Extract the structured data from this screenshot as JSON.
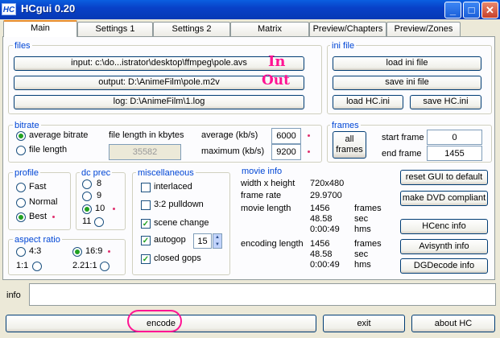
{
  "window": {
    "logo": "HC",
    "title": "HCgui 0.20",
    "minimize": "_",
    "maximize": "□",
    "close": "✕"
  },
  "tabs": [
    "Main",
    "Settings 1",
    "Settings 2",
    "Matrix",
    "Preview/Chapters",
    "Preview/Zones"
  ],
  "files": {
    "title": "files",
    "input_label": "input: c:\\do...istrator\\desktop\\ffmpeg\\pole.avs",
    "output_label": "output: D:\\AnimeFilm\\pole.m2v",
    "log_label": "log: D:\\AnimeFilm\\1.log"
  },
  "ini": {
    "title": "ini file",
    "load": "load ini file",
    "save": "save ini file",
    "load_hc": "load HC.ini",
    "save_hc": "save HC.ini"
  },
  "bitrate": {
    "title": "bitrate",
    "average_bitrate": "average bitrate",
    "file_length": "file length",
    "file_length_kbytes_label": "file length in kbytes",
    "file_length_value": "35582",
    "average_label": "average (kb/s)",
    "average_value": "6000",
    "maximum_label": "maximum (kb/s)",
    "maximum_value": "9200"
  },
  "frames": {
    "title": "frames",
    "all_frames_line1": "all",
    "all_frames_line2": "frames",
    "start_label": "start frame",
    "start_value": "0",
    "end_label": "end frame",
    "end_value": "1455"
  },
  "profile": {
    "title": "profile",
    "fast": "Fast",
    "normal": "Normal",
    "best": "Best"
  },
  "dc_prec": {
    "title": "dc prec",
    "opt8": "8",
    "opt9": "9",
    "opt10": "10",
    "opt11": "11"
  },
  "misc": {
    "title": "miscellaneous",
    "interlaced": "interlaced",
    "pulldown": "3:2 pulldown",
    "scene_change": "scene change",
    "autogop": "autogop",
    "autogop_value": "15",
    "closed_gops": "closed gops"
  },
  "movie_info": {
    "title": "movie info",
    "wxh_label": "width x height",
    "wxh_value": "720x480",
    "fps_label": "frame rate",
    "fps_value": "29.9700",
    "length_label": "movie length",
    "length_frames": "1456",
    "length_sec": "48.58",
    "length_hms": "0:00:49",
    "enc_label": "encoding length",
    "enc_frames": "1456",
    "enc_sec": "48.58",
    "enc_hms": "0:00:49",
    "unit_frames": "frames",
    "unit_sec": "sec",
    "unit_hms": "hms"
  },
  "aspect": {
    "title": "aspect ratio",
    "r43": "4:3",
    "r169": "16:9",
    "r11": "1:1",
    "r221": "2.21:1"
  },
  "right_buttons": {
    "reset": "reset GUI to default",
    "dvd": "make DVD compliant",
    "hcenc": "HCenc info",
    "avisynth": "Avisynth info",
    "dgdecode": "DGDecode info"
  },
  "info": {
    "label": "info"
  },
  "bottom": {
    "encode": "encode",
    "exit": "exit",
    "about": "about HC"
  },
  "annotations": {
    "in": "In",
    "out": "Out"
  },
  "colors": {
    "accent": "#0046d5",
    "titlebar": "#0841c8",
    "radio_dot": "#21a121",
    "annotation": "#ff1493"
  }
}
